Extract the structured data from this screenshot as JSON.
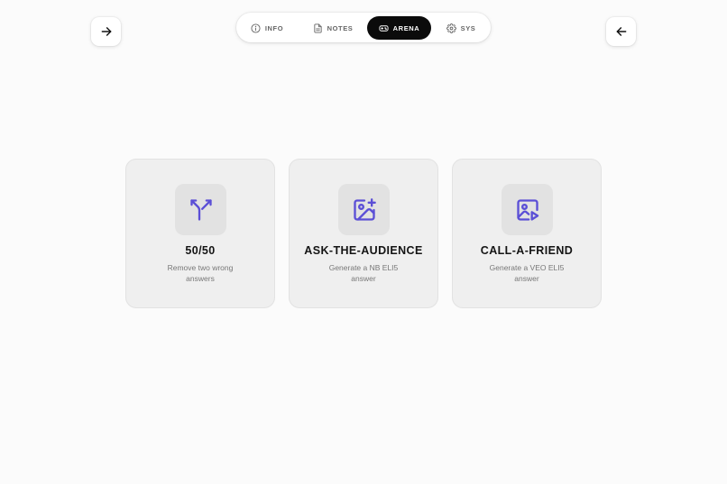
{
  "nav": {
    "tabs": [
      {
        "label": "INFO",
        "icon": "info-icon",
        "active": false
      },
      {
        "label": "NOTES",
        "icon": "document-icon",
        "active": false
      },
      {
        "label": "ARENA",
        "icon": "gamepad-icon",
        "active": true
      },
      {
        "label": "SYS",
        "icon": "gear-icon",
        "active": false
      }
    ]
  },
  "buttons": {
    "forward": {
      "icon": "arrow-right-icon"
    },
    "back": {
      "icon": "arrow-left-icon"
    }
  },
  "lifelines": [
    {
      "title": "50/50",
      "description": "Remove two wrong answers",
      "icon": "split-arrows-icon"
    },
    {
      "title": "ASK-THE-AUDIENCE",
      "description": "Generate a NB ELI5 answer",
      "icon": "image-plus-icon"
    },
    {
      "title": "CALL-A-FRIEND",
      "description": "Generate a VEO ELI5 answer",
      "icon": "image-play-icon"
    }
  ],
  "colors": {
    "accent": "#5b4fd6",
    "active_tab_bg": "#0b0b0b",
    "card_bg": "#efefef",
    "page_bg": "#fbfbfb"
  }
}
